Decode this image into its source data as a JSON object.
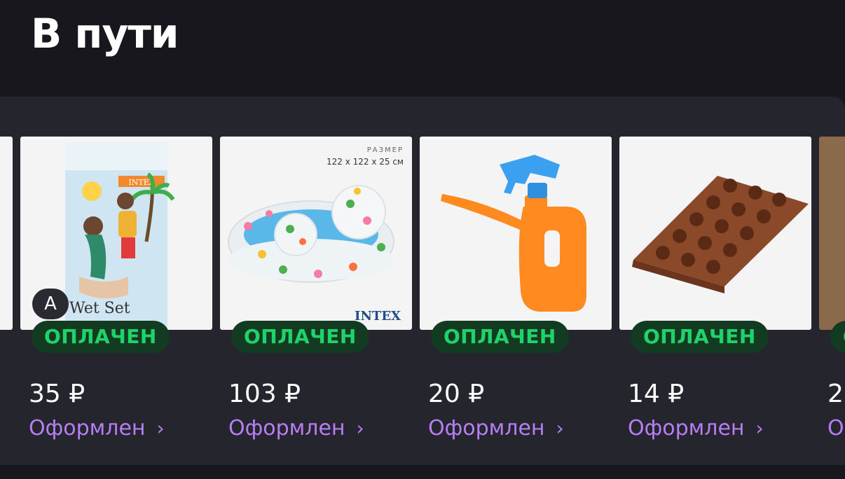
{
  "page": {
    "title": "В пути"
  },
  "items": [
    {
      "status_badge": "ОПЛАЧЕН",
      "price": "35 ₽",
      "status": "Оформлен",
      "image_text": "Wet Set",
      "image_brand": "INTEX"
    },
    {
      "status_badge": "ОПЛАЧЕН",
      "price": "103 ₽",
      "status": "Оформлен",
      "size_label": "РАЗМЕР",
      "size_value": "122 x 122 x 25 см",
      "image_brand": "INTEX"
    },
    {
      "status_badge": "ОПЛАЧЕН",
      "price": "20 ₽",
      "status": "Оформлен"
    },
    {
      "status_badge": "ОПЛАЧЕН",
      "price": "14 ₽",
      "status": "Оформлен"
    },
    {
      "status_badge": "О",
      "price": "2",
      "status": "О"
    }
  ],
  "overlay": {
    "avatar_letter": "A"
  },
  "colors": {
    "badge_bg": "#123b22",
    "badge_text": "#1fd36a",
    "status_text": "#b77ef4",
    "panel_bg": "#25252e",
    "page_bg": "#17171d"
  },
  "icons": {
    "chevron": "chevron-right-icon"
  }
}
